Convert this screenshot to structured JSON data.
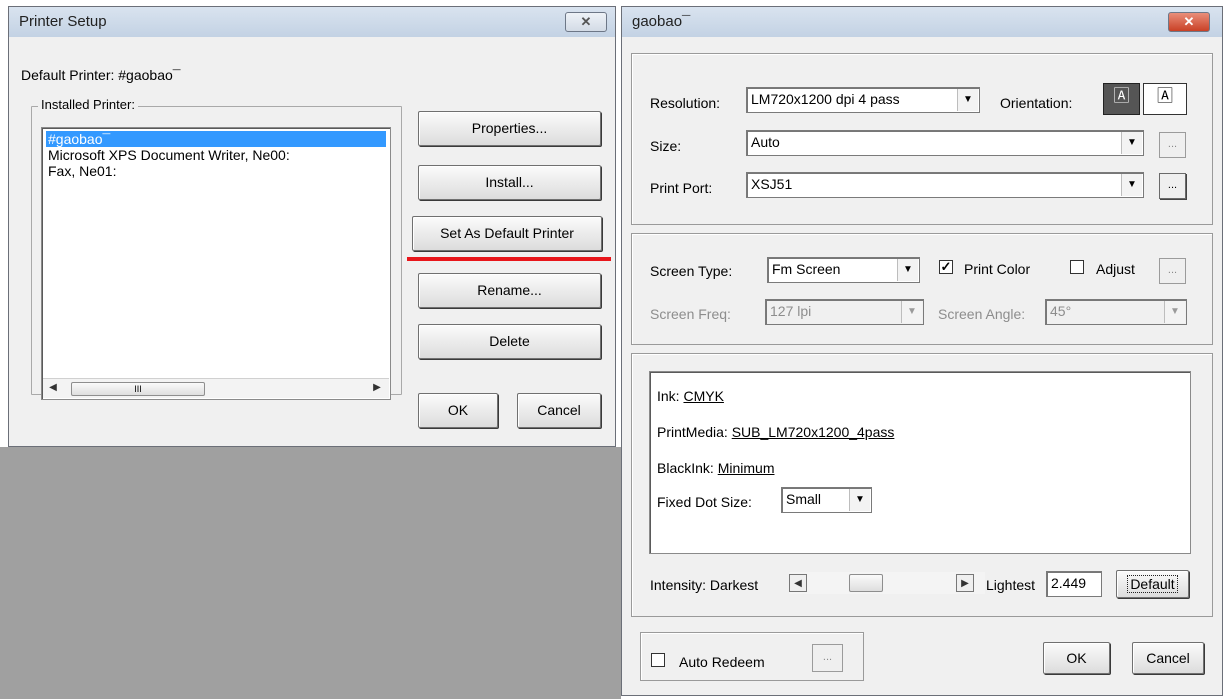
{
  "setup_dialog": {
    "title": "Printer Setup",
    "default_printer": "Default Printer: #gaobao¯",
    "installed_label": "Installed Printer:",
    "printers": [
      "#gaobao¯",
      "Microsoft XPS Document Writer, Ne00:",
      "Fax, Ne01:"
    ],
    "selected_index": 0,
    "buttons": {
      "properties": "Properties...",
      "install": "Install...",
      "set_default": "Set As Default Printer",
      "rename": "Rename...",
      "delete": "Delete",
      "ok": "OK",
      "cancel": "Cancel"
    },
    "scroll_grip": "III",
    "highlight_color": "#e8161b"
  },
  "props_dialog": {
    "title": "gaobao¯",
    "resolution_label": "Resolution:",
    "resolution_value": "LM720x1200 dpi 4 pass",
    "orientation_label": "Orientation:",
    "size_label": "Size:",
    "size_value": "Auto",
    "port_label": "Print Port:",
    "port_value": "XSJ51",
    "ellipsis": "...",
    "screen_type_label": "Screen Type:",
    "screen_type_value": "Fm Screen",
    "print_color_label": "Print Color",
    "print_color_checked": true,
    "adjust_label": "Adjust",
    "adjust_checked": false,
    "screen_freq_label": "Screen Freq:",
    "screen_freq_value": "127 lpi",
    "screen_angle_label": "Screen Angle:",
    "screen_angle_value": "45°",
    "ink_label": "Ink:",
    "ink_value": "CMYK",
    "media_label": "PrintMedia:",
    "media_value": "SUB_LM720x1200_4pass",
    "black_label": "BlackInk:",
    "black_value": "Minimum",
    "dot_label": "Fixed Dot Size:",
    "dot_value": "Small",
    "intensity_label": "Intensity: Darkest",
    "lightest_label": "Lightest",
    "intensity_value": "2.449",
    "default_btn": "Default",
    "auto_redeem_label": "Auto Redeem",
    "auto_redeem_checked": false,
    "ok": "OK",
    "cancel": "Cancel",
    "close_color": "#d9442c"
  }
}
